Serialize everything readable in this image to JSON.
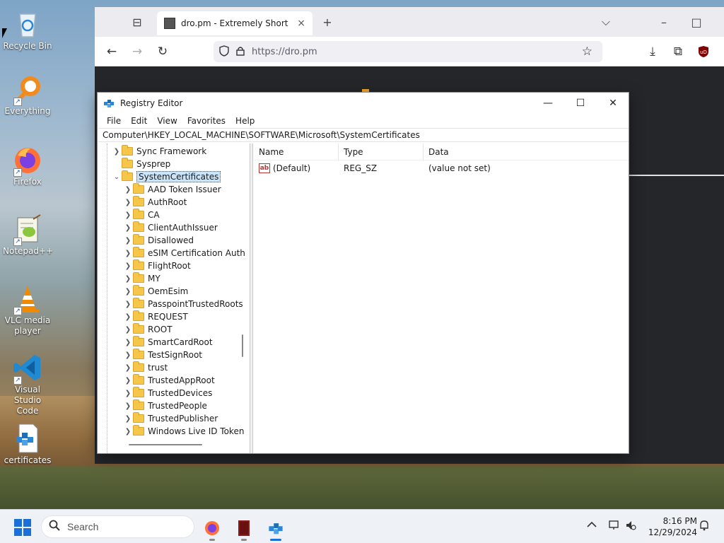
{
  "desktop": {
    "icons": [
      {
        "label": "Recycle Bin",
        "icon": "recycle-bin-icon"
      },
      {
        "label": "Everything",
        "icon": "everything-search-icon"
      },
      {
        "label": "Firefox",
        "icon": "firefox-icon"
      },
      {
        "label": "Notepad++",
        "icon": "notepad-plus-plus-icon"
      },
      {
        "label": "VLC media player",
        "icon": "vlc-cone-icon"
      },
      {
        "label": "Visual Studio Code",
        "icon": "vscode-icon"
      },
      {
        "label": "certificates",
        "icon": "certificates-icon"
      }
    ]
  },
  "browser": {
    "tab_title": "dro.pm - Extremely Short Links",
    "tab_close": "×",
    "new_tab": "+",
    "url": "https://dro.pm",
    "list_all_tabs": "⌵",
    "minimize": "–",
    "maximize": "□",
    "back": "←",
    "forward": "→",
    "reload": "↻",
    "bookmark": "☆",
    "downloads": "⤓",
    "extensions": "⧉",
    "ublock": "uD"
  },
  "regedit": {
    "title": "Registry Editor",
    "controls": {
      "minimize": "—",
      "maximize": "☐",
      "close": "✕"
    },
    "menu": [
      "File",
      "Edit",
      "View",
      "Favorites",
      "Help"
    ],
    "address": "Computer\\HKEY_LOCAL_MACHINE\\SOFTWARE\\Microsoft\\SystemCertificates",
    "tree": {
      "above": [
        {
          "label": "Sync Framework",
          "expandable": true
        },
        {
          "label": "Sysprep",
          "expandable": false
        }
      ],
      "selected": "SystemCertificates",
      "children": [
        "AAD Token Issuer",
        "AuthRoot",
        "CA",
        "ClientAuthIssuer",
        "Disallowed",
        "eSIM Certification Auth",
        "FlightRoot",
        "MY",
        "OemEsim",
        "PasspointTrustedRoots",
        "REQUEST",
        "ROOT",
        "SmartCardRoot",
        "TestSignRoot",
        "trust",
        "TrustedAppRoot",
        "TrustedDevices",
        "TrustedPeople",
        "TrustedPublisher",
        "Windows Live ID Token"
      ]
    },
    "list": {
      "columns": [
        "Name",
        "Type",
        "Data"
      ],
      "rows": [
        {
          "name": "(Default)",
          "type": "REG_SZ",
          "data": "(value not set)"
        }
      ]
    }
  },
  "taskbar": {
    "search_placeholder": "Search",
    "apps": [
      "firefox-icon",
      "book-app-icon",
      "registry-editor-icon"
    ],
    "time": "8:16 PM",
    "date": "12/29/2024",
    "colors": {
      "accent": "#1a6fd8"
    }
  }
}
